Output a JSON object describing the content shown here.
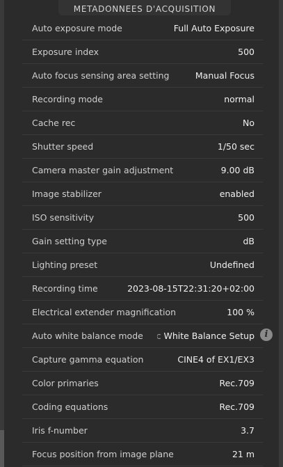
{
  "header": {
    "title": "METADONNEES D'ACQUISITION"
  },
  "rows": [
    {
      "label": "Auto exposure mode",
      "value": "Full Auto Exposure"
    },
    {
      "label": "Exposure index",
      "value": "500"
    },
    {
      "label": "Auto focus sensing area setting",
      "value": "Manual Focus"
    },
    {
      "label": "Recording mode",
      "value": "normal"
    },
    {
      "label": "Cache rec",
      "value": "No"
    },
    {
      "label": "Shutter speed",
      "value": "1/50 sec"
    },
    {
      "label": "Camera master gain adjustment",
      "value": "9.00 dB"
    },
    {
      "label": "Image stabilizer",
      "value": "enabled"
    },
    {
      "label": "ISO sensitivity",
      "value": "500"
    },
    {
      "label": "Gain setting type",
      "value": "dB"
    },
    {
      "label": "Lighting preset",
      "value": "Undefined"
    },
    {
      "label": "Recording time",
      "value": "2023-08-15T22:31:20+02:00"
    },
    {
      "label": "Electrical extender magnification",
      "value": "100 %"
    },
    {
      "label": "Auto white balance mode",
      "value": "Automatic White Balance Setup"
    },
    {
      "label": "Capture gamma equation",
      "value": "CINE4 of EX1/EX3"
    },
    {
      "label": "Color primaries",
      "value": "Rec.709"
    },
    {
      "label": "Coding equations",
      "value": "Rec.709"
    },
    {
      "label": "Iris f-number",
      "value": "3.7"
    },
    {
      "label": "Focus position from image plane",
      "value": "21 m"
    }
  ],
  "icons": {
    "info": "info-icon"
  }
}
